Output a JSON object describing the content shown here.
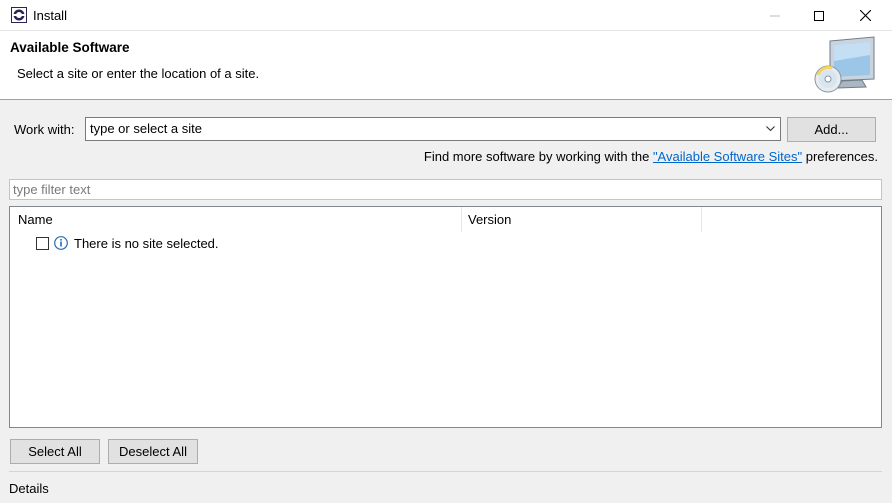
{
  "window": {
    "title": "Install"
  },
  "banner": {
    "title": "Available Software",
    "description": "Select a site or enter the location of a site."
  },
  "work_with": {
    "label": "Work with:",
    "value": "type or select a site",
    "add_button": "Add..."
  },
  "find_more": {
    "prefix": "Find more software by working with the ",
    "link": "\"Available Software Sites\"",
    "suffix": " preferences."
  },
  "filter": {
    "placeholder": "type filter text"
  },
  "table": {
    "columns": [
      "Name",
      "Version"
    ],
    "rows": [
      {
        "label": "There is no site selected.",
        "checked": false,
        "icon": "info-icon"
      }
    ]
  },
  "actions": {
    "select_all": "Select All",
    "deselect_all": "Deselect All"
  },
  "details": {
    "label": "Details"
  }
}
